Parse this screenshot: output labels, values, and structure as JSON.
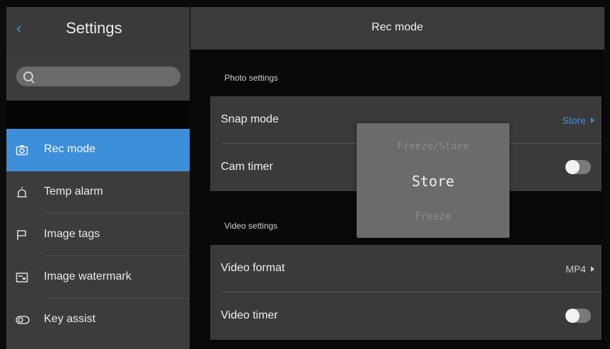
{
  "sidebar": {
    "back_icon": "chevron-left-icon",
    "title": "Settings",
    "search": {
      "placeholder": "",
      "value": ""
    },
    "items": [
      {
        "label": "Rec mode",
        "icon": "camera-icon",
        "active": true
      },
      {
        "label": "Temp alarm",
        "icon": "alarm-icon",
        "active": false
      },
      {
        "label": "Image tags",
        "icon": "flag-icon",
        "active": false
      },
      {
        "label": "Image watermark",
        "icon": "watermark-icon",
        "active": false
      },
      {
        "label": "Key assist",
        "icon": "toggle-key-icon",
        "active": false
      }
    ]
  },
  "main": {
    "title": "Rec mode",
    "photo_section": {
      "title": "Photo settings",
      "snap_mode": {
        "label": "Snap mode",
        "value": "Store"
      },
      "cam_timer": {
        "label": "Cam timer",
        "enabled": false
      }
    },
    "video_section": {
      "title": "Video settings",
      "video_format": {
        "label": "Video format",
        "value": "MP4"
      },
      "video_timer": {
        "label": "Video timer",
        "enabled": false
      }
    }
  },
  "picker": {
    "options": [
      "Freeze/Store",
      "Store",
      "Freeze"
    ],
    "selected": "Store"
  },
  "colors": {
    "accent": "#3d8ed8",
    "sidebar_bg": "#3c3c3c",
    "card_bg": "#3a3a3a",
    "background": "#080808"
  }
}
